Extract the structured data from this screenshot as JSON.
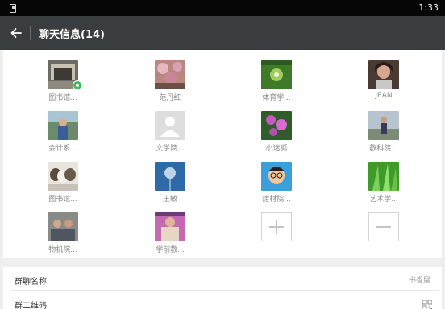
{
  "status_bar": {
    "time": "1:33"
  },
  "header": {
    "title": "聊天信息(14)"
  },
  "members": [
    {
      "name": "图书馆...",
      "icon": "photo-avatar-1"
    },
    {
      "name": "范丹红",
      "icon": "photo-avatar-2"
    },
    {
      "name": "体育学...",
      "icon": "photo-avatar-3"
    },
    {
      "name": "JEAN",
      "icon": "photo-avatar-4"
    },
    {
      "name": "会计系...",
      "icon": "photo-avatar-5"
    },
    {
      "name": "文学院...",
      "icon": "default-avatar"
    },
    {
      "name": "小迷狐",
      "icon": "photo-avatar-7"
    },
    {
      "name": "教科院...",
      "icon": "photo-avatar-8"
    },
    {
      "name": "图书馆...",
      "icon": "photo-avatar-9"
    },
    {
      "name": "王敏",
      "icon": "photo-avatar-10"
    },
    {
      "name": "建材院...",
      "icon": "photo-avatar-11"
    },
    {
      "name": "艺术学...",
      "icon": "photo-avatar-12"
    },
    {
      "name": "物机院...",
      "icon": "photo-avatar-13"
    },
    {
      "name": "学前教...",
      "icon": "photo-avatar-14"
    }
  ],
  "settings": {
    "group_name_label": "群聊名称",
    "group_name_value": "书香屋",
    "qr_label": "群二维码"
  },
  "colors": {
    "header_bg": "#3a3d3f",
    "status_bg": "#050505",
    "badge_green": "#3cbf55",
    "section_bg": "#efefef"
  }
}
